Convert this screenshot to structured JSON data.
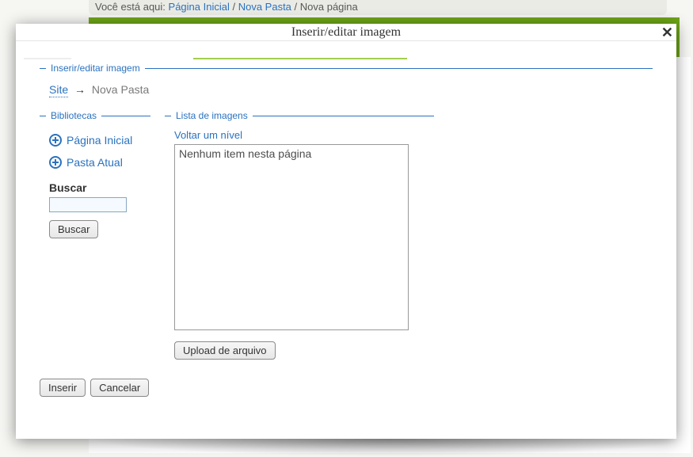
{
  "background": {
    "breadcrumb_prefix": "Você está aqui:",
    "breadcrumb_items": [
      "Página Inicial",
      "Nova Pasta"
    ],
    "breadcrumb_current": "Nova página"
  },
  "modal": {
    "title": "Inserir/editar imagem",
    "close_label": "✕",
    "fieldset_main_legend": "Inserir/editar imagem",
    "breadcrumb": {
      "root": "Site",
      "arrow": "→",
      "current": "Nova Pasta"
    },
    "libraries": {
      "legend": "Bibliotecas",
      "items": [
        {
          "label": "Página Inicial"
        },
        {
          "label": "Pasta Atual"
        }
      ],
      "search_label": "Buscar",
      "search_button": "Buscar"
    },
    "image_list": {
      "legend": "Lista de imagens",
      "up_link": "Voltar um nível",
      "empty_message": "Nenhum item nesta página",
      "upload_button": "Upload de arquivo"
    },
    "actions": {
      "insert": "Inserir",
      "cancel": "Cancelar"
    }
  }
}
